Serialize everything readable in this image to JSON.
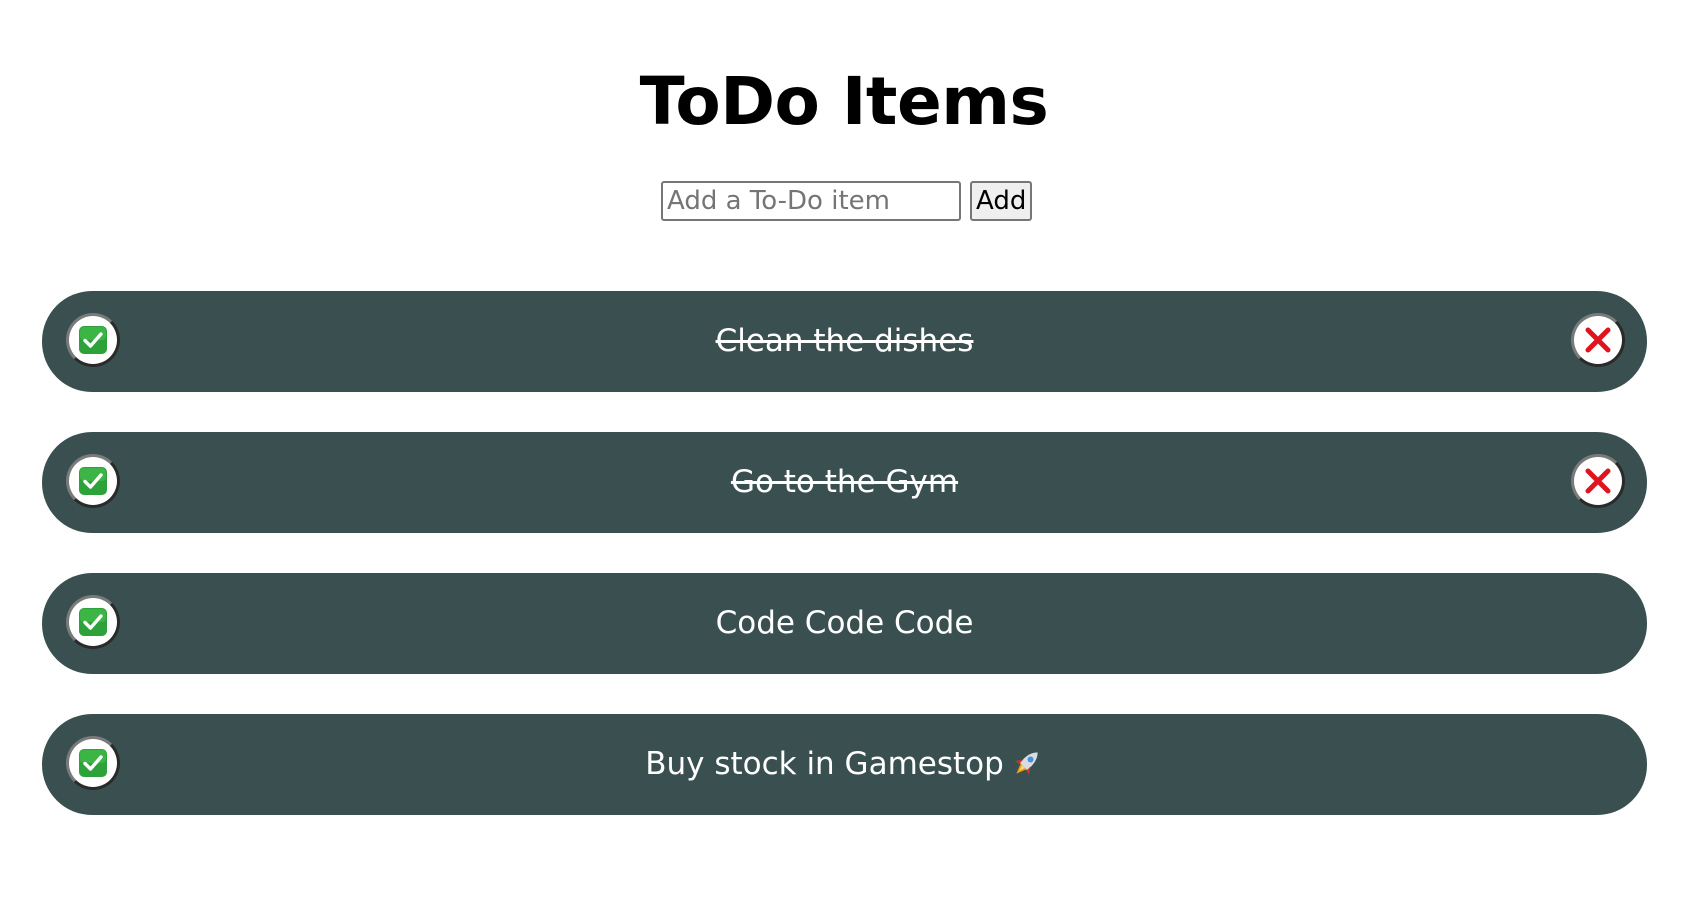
{
  "page": {
    "title": "ToDo Items"
  },
  "add_form": {
    "placeholder": "Add a To-Do item",
    "value": "",
    "button_label": "Add"
  },
  "todos": [
    {
      "text": "Clean the dishes",
      "completed": true,
      "show_delete": true
    },
    {
      "text": "Go to the Gym",
      "completed": true,
      "show_delete": true
    },
    {
      "text": "Code Code Code",
      "completed": false,
      "show_delete": false
    },
    {
      "text": "Buy stock in Gamestop",
      "completed": false,
      "show_delete": false,
      "emoji": "rocket-icon"
    }
  ],
  "icons": {
    "complete": "check-mark-button-icon",
    "delete": "cross-mark-icon"
  },
  "colors": {
    "item_background": "#3a5050",
    "item_text": "#ffffff",
    "check_green": "#2ea23a",
    "delete_red": "#e0141e"
  }
}
